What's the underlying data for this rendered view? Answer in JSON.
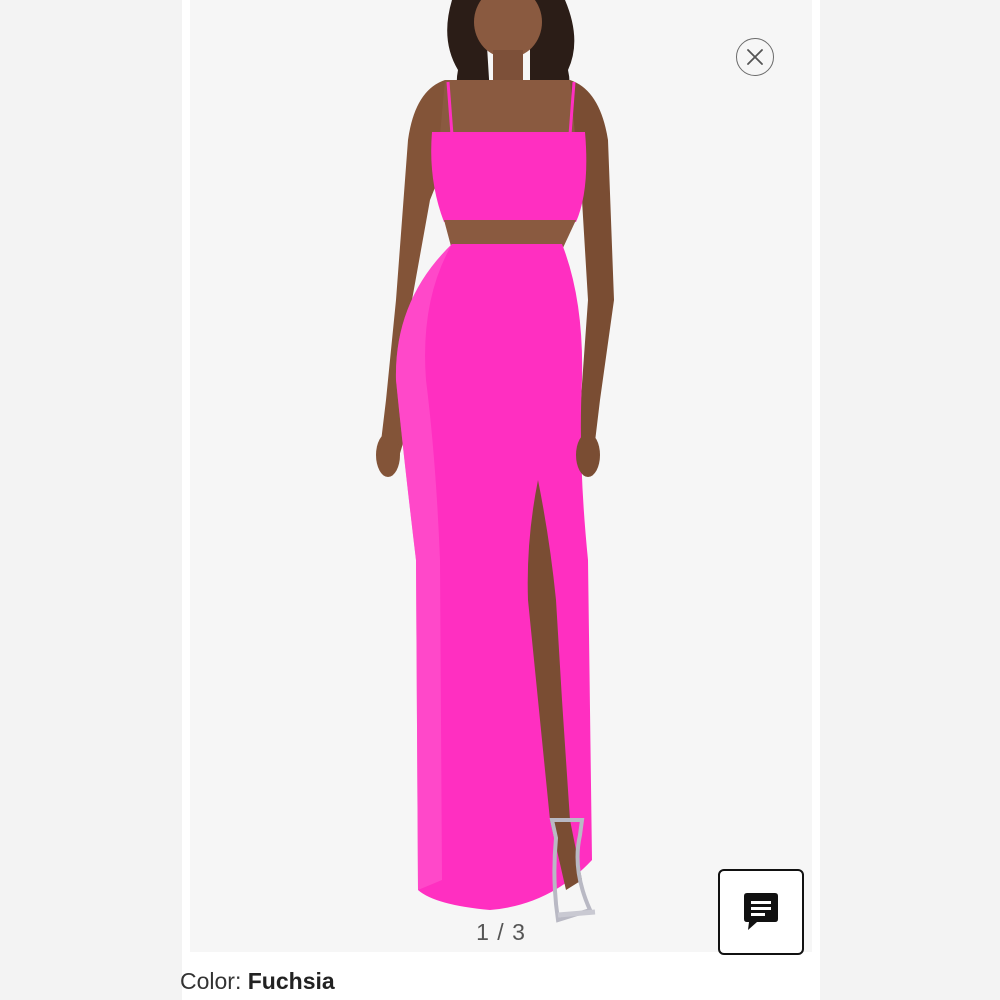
{
  "gallery": {
    "counter": "1 / 3",
    "dress_color": "#ff2fc1",
    "image_subject": "model wearing fuchsia column gown with side cutouts and thigh slit"
  },
  "product": {
    "color_label": "Color:",
    "color_value": "Fuchsia"
  },
  "icons": {
    "close": "close-icon",
    "chat": "chat-bubble-icon"
  }
}
